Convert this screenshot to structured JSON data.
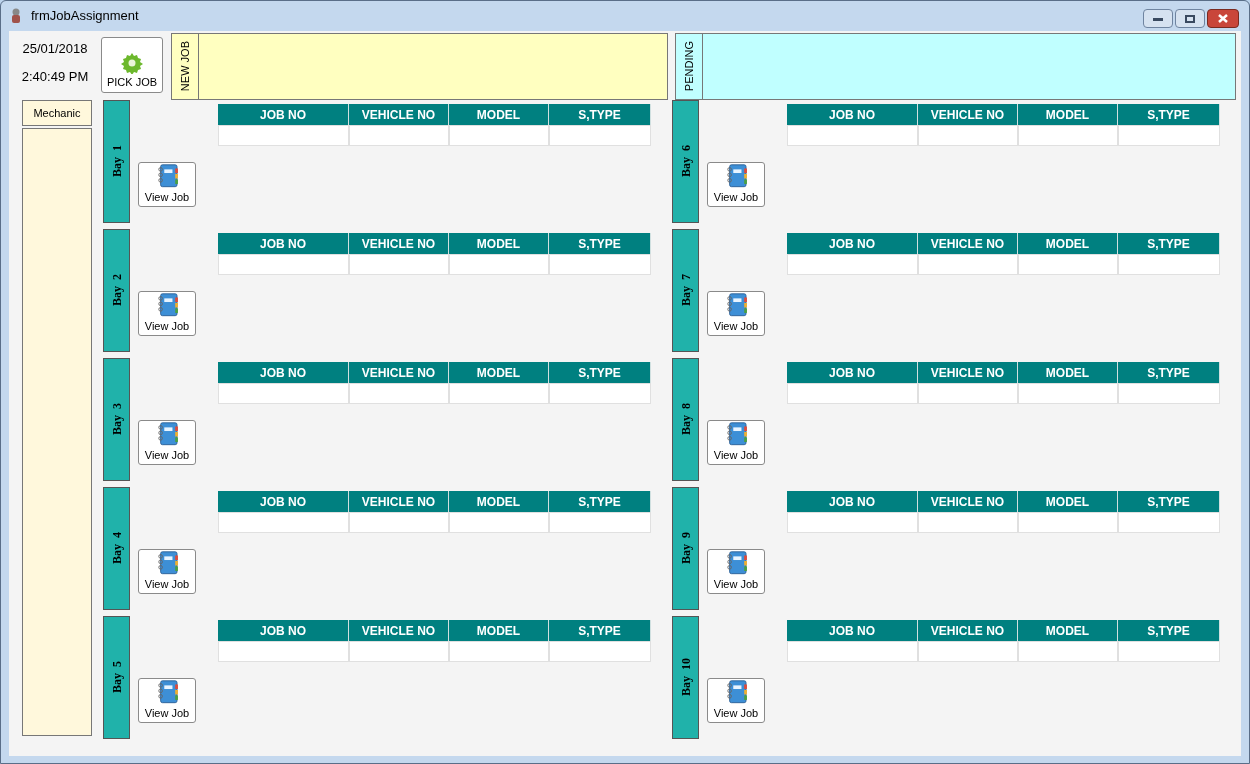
{
  "window": {
    "title": "frmJobAssignment"
  },
  "clock": {
    "date": "25/01/2018",
    "time": "2:40:49 PM"
  },
  "pick_job_button": {
    "label": "PICK JOB"
  },
  "panels": [
    {
      "label": "NEW JOB",
      "color": "#ffffc0"
    },
    {
      "label": "PENDING",
      "color": "#c0ffff"
    }
  ],
  "mechanic": {
    "header": "Mechanic"
  },
  "bays": [
    {
      "label": "Bay  1",
      "columns": [
        "JOB NO",
        "VEHICLE NO",
        "MODEL",
        "S,TYPE"
      ],
      "button": "View Job"
    },
    {
      "label": "Bay  2",
      "columns": [
        "JOB NO",
        "VEHICLE NO",
        "MODEL",
        "S,TYPE"
      ],
      "button": "View Job"
    },
    {
      "label": "Bay  3",
      "columns": [
        "JOB NO",
        "VEHICLE NO",
        "MODEL",
        "S,TYPE"
      ],
      "button": "View Job"
    },
    {
      "label": "Bay  4",
      "columns": [
        "JOB NO",
        "VEHICLE NO",
        "MODEL",
        "S,TYPE"
      ],
      "button": "View Job"
    },
    {
      "label": "Bay  5",
      "columns": [
        "JOB NO",
        "VEHICLE NO",
        "MODEL",
        "S,TYPE"
      ],
      "button": "View Job"
    },
    {
      "label": "Bay  6",
      "columns": [
        "JOB NO",
        "VEHICLE NO",
        "MODEL",
        "S,TYPE"
      ],
      "button": "View Job"
    },
    {
      "label": "Bay  7",
      "columns": [
        "JOB NO",
        "VEHICLE NO",
        "MODEL",
        "S,TYPE"
      ],
      "button": "View Job"
    },
    {
      "label": "Bay  8",
      "columns": [
        "JOB NO",
        "VEHICLE NO",
        "MODEL",
        "S,TYPE"
      ],
      "button": "View Job"
    },
    {
      "label": "Bay  9",
      "columns": [
        "JOB NO",
        "VEHICLE NO",
        "MODEL",
        "S,TYPE"
      ],
      "button": "View Job"
    },
    {
      "label": "Bay  10",
      "columns": [
        "JOB NO",
        "VEHICLE NO",
        "MODEL",
        "S,TYPE"
      ],
      "button": "View Job"
    }
  ]
}
